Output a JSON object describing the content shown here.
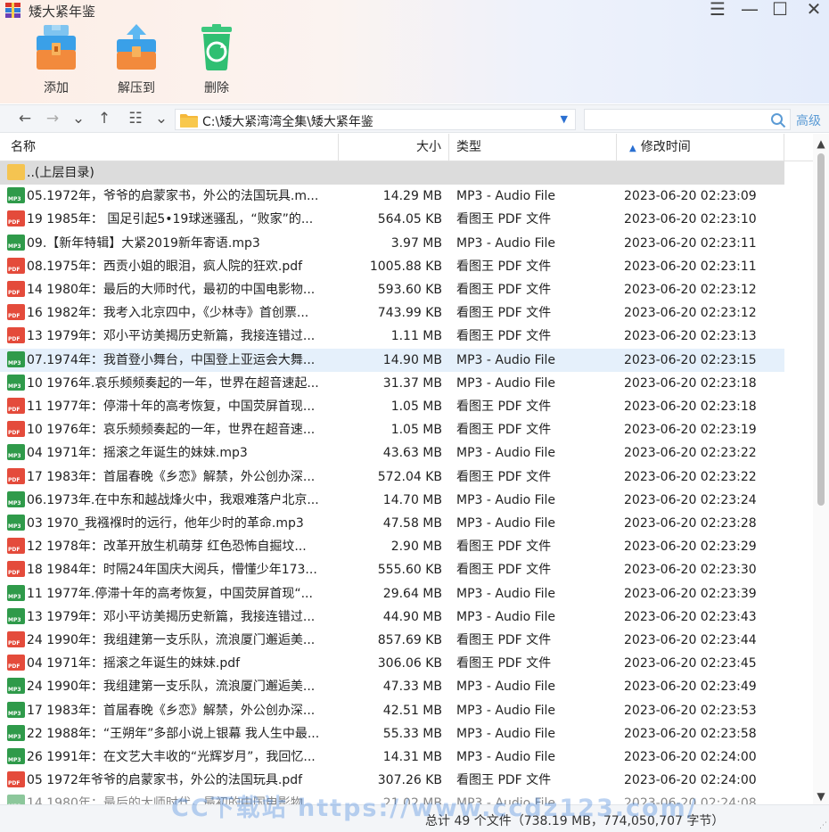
{
  "window": {
    "title": "矮大紧年鉴",
    "menu_glyph": "☰",
    "minimize_glyph": "—",
    "maximize_glyph": "☐",
    "close_glyph": "✕"
  },
  "toolbar": {
    "add_label": "添加",
    "extract_label": "解压到",
    "delete_label": "删除",
    "accent": "#2a6fd1"
  },
  "nav": {
    "back_glyph": "←",
    "forward_glyph": "→",
    "history_glyph": "⌄",
    "up_glyph": "↑",
    "view_glyph": "☷",
    "view_dd_glyph": "⌄",
    "path": "C:\\矮大紧湾湾全集\\矮大紧年鉴",
    "path_dropdown_glyph": "▼",
    "search_value": "",
    "advanced_label": "高级"
  },
  "columns": {
    "name": "名称",
    "size": "大小",
    "type": "类型",
    "time_sort_glyph": "▲",
    "time": "修改时间"
  },
  "parent_row": {
    "name": "..(上层目录)"
  },
  "files": [
    {
      "icon": "mp3",
      "name": "05.1972年，爷爷的启蒙家书，外公的法国玩具.m...",
      "size": "14.29 MB",
      "type": "MP3 - Audio File",
      "time": "2023-06-20 02:23:09"
    },
    {
      "icon": "pdf",
      "name": "19 1985年： 国足引起5•19球迷骚乱，“败家”的...",
      "size": "564.05 KB",
      "type": "看图王 PDF 文件",
      "time": "2023-06-20 02:23:10"
    },
    {
      "icon": "mp3",
      "name": "09.【新年特辑】大紧2019新年寄语.mp3",
      "size": "3.97 MB",
      "type": "MP3 - Audio File",
      "time": "2023-06-20 02:23:11"
    },
    {
      "icon": "pdf",
      "name": "08.1975年：西贡小姐的眼泪，疯人院的狂欢.pdf",
      "size": "1005.88 KB",
      "type": "看图王 PDF 文件",
      "time": "2023-06-20 02:23:11"
    },
    {
      "icon": "pdf",
      "name": "14 1980年：最后的大师时代，最初的中国电影物...",
      "size": "593.60 KB",
      "type": "看图王 PDF 文件",
      "time": "2023-06-20 02:23:12"
    },
    {
      "icon": "pdf",
      "name": "16 1982年：我考入北京四中，《少林寺》首创票...",
      "size": "743.99 KB",
      "type": "看图王 PDF 文件",
      "time": "2023-06-20 02:23:12"
    },
    {
      "icon": "pdf",
      "name": "13 1979年：邓小平访美揭历史新篇，我接连错过...",
      "size": "1.11 MB",
      "type": "看图王 PDF 文件",
      "time": "2023-06-20 02:23:13"
    },
    {
      "icon": "mp3",
      "name": "07.1974年：我首登小舞台，中国登上亚运会大舞...",
      "size": "14.90 MB",
      "type": "MP3 - Audio File",
      "time": "2023-06-20 02:23:15",
      "selected": true
    },
    {
      "icon": "mp3",
      "name": "10 1976年.哀乐频频奏起的一年，世界在超音速起...",
      "size": "31.37 MB",
      "type": "MP3 - Audio File",
      "time": "2023-06-20 02:23:18"
    },
    {
      "icon": "pdf",
      "name": "11 1977年：停滞十年的高考恢复，中国荧屏首现...",
      "size": "1.05 MB",
      "type": "看图王 PDF 文件",
      "time": "2023-06-20 02:23:18"
    },
    {
      "icon": "pdf",
      "name": "10 1976年：哀乐频频奏起的一年，世界在超音速...",
      "size": "1.05 MB",
      "type": "看图王 PDF 文件",
      "time": "2023-06-20 02:23:19"
    },
    {
      "icon": "mp3",
      "name": "04 1971年：摇滚之年诞生的妹妹.mp3",
      "size": "43.63 MB",
      "type": "MP3 - Audio File",
      "time": "2023-06-20 02:23:22"
    },
    {
      "icon": "pdf",
      "name": "17 1983年：首届春晚《乡恋》解禁，外公创办深...",
      "size": "572.04 KB",
      "type": "看图王 PDF 文件",
      "time": "2023-06-20 02:23:22"
    },
    {
      "icon": "mp3",
      "name": "06.1973年.在中东和越战烽火中，我艰难落户北京...",
      "size": "14.70 MB",
      "type": "MP3 - Audio File",
      "time": "2023-06-20 02:23:24"
    },
    {
      "icon": "mp3",
      "name": "03 1970_我襁褓时的远行，他年少时的革命.mp3",
      "size": "47.58 MB",
      "type": "MP3 - Audio File",
      "time": "2023-06-20 02:23:28"
    },
    {
      "icon": "pdf",
      "name": "12 1978年：改革开放生机萌芽 红色恐怖自掘坟...",
      "size": "2.90 MB",
      "type": "看图王 PDF 文件",
      "time": "2023-06-20 02:23:29"
    },
    {
      "icon": "pdf",
      "name": "18 1984年：时隔24年国庆大阅兵，懵懂少年173...",
      "size": "555.60 KB",
      "type": "看图王 PDF 文件",
      "time": "2023-06-20 02:23:30"
    },
    {
      "icon": "mp3",
      "name": "11 1977年.停滞十年的高考恢复，中国荧屏首现“...",
      "size": "29.64 MB",
      "type": "MP3 - Audio File",
      "time": "2023-06-20 02:23:39"
    },
    {
      "icon": "mp3",
      "name": "13 1979年：邓小平访美揭历史新篇，我接连错过...",
      "size": "44.90 MB",
      "type": "MP3 - Audio File",
      "time": "2023-06-20 02:23:43"
    },
    {
      "icon": "pdf",
      "name": "24 1990年：我组建第一支乐队，流浪厦门邂逅美...",
      "size": "857.69 KB",
      "type": "看图王 PDF 文件",
      "time": "2023-06-20 02:23:44"
    },
    {
      "icon": "pdf",
      "name": "04 1971年：摇滚之年诞生的妹妹.pdf",
      "size": "306.06 KB",
      "type": "看图王 PDF 文件",
      "time": "2023-06-20 02:23:45"
    },
    {
      "icon": "mp3",
      "name": "24 1990年：我组建第一支乐队，流浪厦门邂逅美...",
      "size": "47.33 MB",
      "type": "MP3 - Audio File",
      "time": "2023-06-20 02:23:49"
    },
    {
      "icon": "mp3",
      "name": "17 1983年：首届春晚《乡恋》解禁，外公创办深...",
      "size": "42.51 MB",
      "type": "MP3 - Audio File",
      "time": "2023-06-20 02:23:53"
    },
    {
      "icon": "mp3",
      "name": "22 1988年：“王朔年”多部小说上银幕 我人生中最...",
      "size": "55.33 MB",
      "type": "MP3 - Audio File",
      "time": "2023-06-20 02:23:58"
    },
    {
      "icon": "mp3",
      "name": "26 1991年：在文艺大丰收的“光辉岁月”，我回忆...",
      "size": "14.31 MB",
      "type": "MP3 - Audio File",
      "time": "2023-06-20 02:24:00"
    },
    {
      "icon": "pdf",
      "name": "05 1972年爷爷的启蒙家书，外公的法国玩具.pdf",
      "size": "307.26 KB",
      "type": "看图王 PDF 文件",
      "time": "2023-06-20 02:24:00"
    },
    {
      "icon": "mp3",
      "name": "14 1980年：最后的大师时代，最初的中国电影物...",
      "size": "21.02 MB",
      "type": "MP3 - Audio File",
      "time": "2023-06-20 02:24:08",
      "dim": true
    }
  ],
  "status": {
    "summary": "总计 49 个文件（738.19 MB，774,050,707 字节）",
    "watermark": "CC下载站 https://www.ccdz123.com/"
  }
}
